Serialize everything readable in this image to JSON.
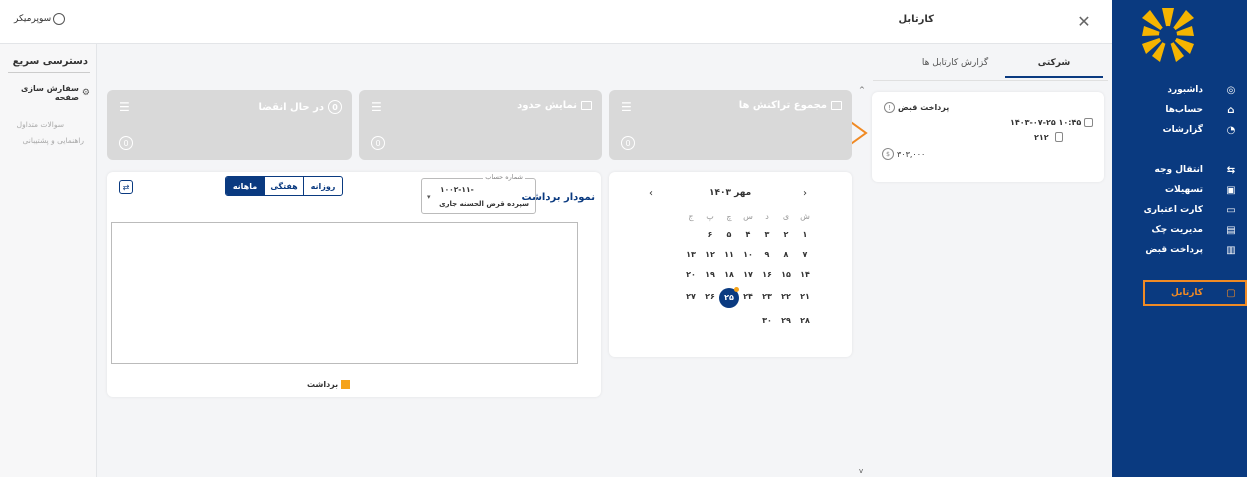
{
  "topbar": {
    "page_title": "کارتابل",
    "user_label": "سوپرمیکر"
  },
  "tabs": [
    {
      "label": "شرکتی",
      "active": true
    },
    {
      "label": "گزارش کارتابل ها",
      "active": false
    }
  ],
  "sidebar": {
    "items": [
      {
        "label": "داشبورد",
        "icon": "dashboard-icon"
      },
      {
        "label": "حساب‌ها",
        "icon": "bank-icon"
      },
      {
        "label": "گزارشات",
        "icon": "chart-pie-icon"
      },
      {
        "label": "انتقال وجه",
        "icon": "transfer-icon"
      },
      {
        "label": "تسهیلات",
        "icon": "loan-icon"
      },
      {
        "label": "کارت اعتباری",
        "icon": "credit-card-icon"
      },
      {
        "label": "مدیریت چک",
        "icon": "cheque-icon"
      },
      {
        "label": "پرداخت قبض",
        "icon": "bill-icon"
      },
      {
        "label": "کارتابل",
        "icon": "briefcase-icon",
        "active": true
      }
    ]
  },
  "quick_access": {
    "title": "دسترسی سریع",
    "customize": "سفارش سازی صفحه",
    "links": [
      "سوالات متداول",
      "راهنمایی و پشتیبانی"
    ]
  },
  "stats": [
    {
      "title": "مجموع تراکنش ها",
      "count": "0"
    },
    {
      "title": "نمایش حدود",
      "count": "0"
    },
    {
      "title": "در حال انقضا",
      "count": "0"
    }
  ],
  "request_card": {
    "title": "پرداخت قبض",
    "datetime": "۱۴۰۳-۰۷-۲۵ ۱۰:۴۵",
    "user": "۲۱۲",
    "amount": "۳۰۳,۰۰۰"
  },
  "calendar": {
    "month_label": "مهر ۱۴۰۳",
    "weekdays": [
      "ش",
      "ی",
      "د",
      "س",
      "چ",
      "پ",
      "ج"
    ],
    "rows": [
      [
        "",
        "",
        "",
        "",
        "",
        "",
        ""
      ],
      [
        "۱",
        "۲",
        "۳",
        "۴",
        "۵",
        "۶"
      ],
      [
        "۷",
        "۸",
        "۹",
        "۱۰",
        "۱۱",
        "۱۲",
        "۱۳"
      ],
      [
        "۱۴",
        "۱۵",
        "۱۶",
        "۱۷",
        "۱۸",
        "۱۹",
        "۲۰"
      ],
      [
        "۲۱",
        "۲۲",
        "۲۳",
        "۲۴",
        "۲۵",
        "۲۶",
        "۲۷"
      ],
      [
        "۲۸",
        "۲۹",
        "۳۰"
      ]
    ],
    "selected": "۲۵",
    "accent": "#0a3a80"
  },
  "chart_panel": {
    "title": "نمودار برداشت",
    "account_label": "شماره حساب",
    "account_number": "۱۰۰۲-۱۱-",
    "account_type": "سپرده قرض الحسنه جاری",
    "periods": [
      "روزانه",
      "هفتگی",
      "ماهانه"
    ],
    "active_period": "ماهانه",
    "legend": "برداشت",
    "legend_color": "#f5a31a"
  },
  "colors": {
    "primary": "#0a3a80",
    "accent_orange": "#f08a24"
  }
}
